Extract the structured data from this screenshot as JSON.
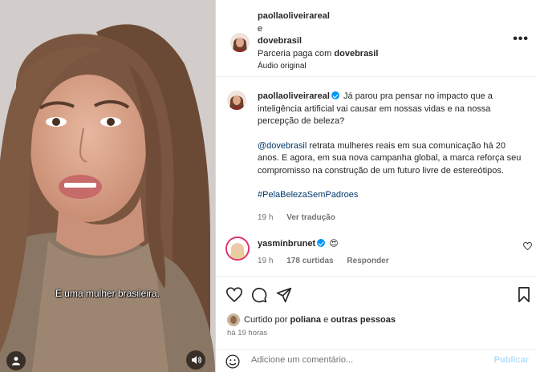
{
  "video": {
    "subtitle": "E uma mulher brasileira."
  },
  "header": {
    "author": "paollaoliveirareal",
    "connector": "e",
    "coauthor": "dovebrasil",
    "partnership_prefix": "Parceria paga com",
    "partner": "dovebrasil",
    "audio": "Áudio original"
  },
  "caption": {
    "author": "paollaoliveirareal",
    "p1": "Já parou pra pensar no impacto que a inteligência artificial vai causar em nossas vidas e na nossa percepção de beleza?",
    "mention": "@dovebrasil",
    "p2_rest": "retrata mulheres reais em sua comunicação há 20 anos. E agora, em sua nova campanha global, a marca reforça seu compromisso na construção de um futuro livre de estereótipos.",
    "hashtag": "#PelaBelezaSemPadroes",
    "time": "19 h",
    "translate": "Ver tradução"
  },
  "comment": {
    "user": "yasminbrunet",
    "text": "😍",
    "time": "19 h",
    "likes": "178 curtidas",
    "reply": "Responder"
  },
  "likes_line": {
    "prefix": "Curtido por",
    "user": "poliana",
    "middle": "e",
    "others": "outras pessoas"
  },
  "posted_ago": "há 19 horas",
  "add_comment": {
    "placeholder": "Adicione um comentário...",
    "publish": "Publicar"
  },
  "colors": {
    "accent": "#0095f6",
    "link": "#00376b",
    "muted": "#737373"
  }
}
